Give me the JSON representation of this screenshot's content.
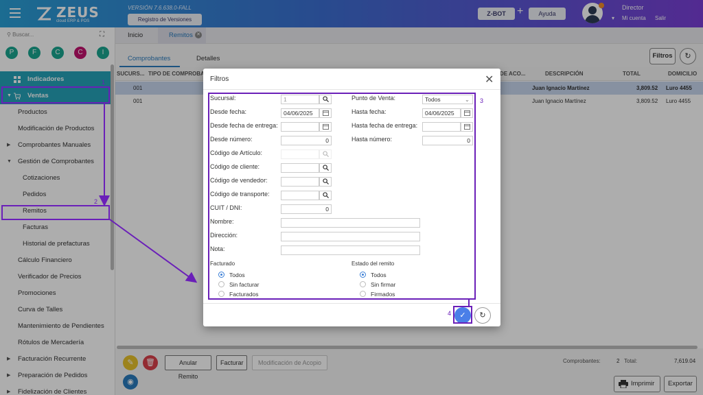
{
  "header": {
    "brand": "ZEUS",
    "brand_sub": "cloud ERP & POS",
    "version": "VERSIÓN 7.6.638.0-FALL",
    "registro_btn": "Registro de Versiones",
    "zbot_btn": "Z-BOT",
    "plus": "+",
    "ayuda_btn": "Ayuda",
    "user_role": "Director",
    "mi_cuenta": "Mi cuenta",
    "salir": "Salir"
  },
  "sidebar": {
    "search_placeholder": "Buscar...",
    "quick": [
      "P",
      "F",
      "C",
      "C",
      "I"
    ],
    "items": [
      {
        "label": "Indicadores"
      },
      {
        "label": "Ventas"
      },
      {
        "label": "Productos"
      },
      {
        "label": "Modificación de Productos"
      },
      {
        "label": "Comprobantes Manuales"
      },
      {
        "label": "Gestión de Comprobantes"
      },
      {
        "label": "Cotizaciones"
      },
      {
        "label": "Pedidos"
      },
      {
        "label": "Remitos"
      },
      {
        "label": "Facturas"
      },
      {
        "label": "Historial de prefacturas"
      },
      {
        "label": "Cálculo Financiero"
      },
      {
        "label": "Verificador de Precios"
      },
      {
        "label": "Promociones"
      },
      {
        "label": "Curva de Talles"
      },
      {
        "label": "Mantenimiento de Pendientes"
      },
      {
        "label": "Rótulos de Mercadería"
      },
      {
        "label": "Facturación Recurrente"
      },
      {
        "label": "Preparación de Pedidos"
      },
      {
        "label": "Fidelización de Clientes"
      }
    ]
  },
  "tabs": {
    "inicio": "Inicio",
    "remitos": "Remitos"
  },
  "subtabs": {
    "comprobantes": "Comprobantes",
    "detalles": "Detalles",
    "filtros_btn": "Filtros"
  },
  "grid": {
    "headers": {
      "sucursal": "SUCURS...",
      "tipo": "TIPO DE COMPROBA...",
      "acopio": "DE ACO...",
      "descripcion": "DESCRIPCIÓN",
      "total": "TOTAL",
      "domicilio": "DOMICILIO"
    },
    "rows": [
      {
        "sucursal": "001",
        "descripcion": "Juan Ignacio Martínez",
        "total": "3,809.52",
        "domicilio": "Luro 4455"
      },
      {
        "sucursal": "001",
        "descripcion": "Juan Ignacio Martínez",
        "total": "3,809.52",
        "domicilio": "Luro 4455"
      }
    ]
  },
  "bottom": {
    "anular": "Anular Remito",
    "facturar": "Facturar",
    "acopio": "Modificación de Acopio",
    "comprobantes_lbl": "Comprobantes:",
    "comprobantes_val": "2",
    "total_lbl": "Total:",
    "total_val": "7,619.04",
    "imprimir": "Imprimir",
    "exportar": "Exportar"
  },
  "modal": {
    "title": "Filtros",
    "sucursal_lbl": "Sucursal:",
    "sucursal_val": "1",
    "pv_lbl": "Punto de Venta:",
    "pv_val": "Todos",
    "desde_fecha_lbl": "Desde fecha:",
    "desde_fecha_val": "04/06/2025",
    "hasta_fecha_lbl": "Hasta fecha:",
    "hasta_fecha_val": "04/06/2025",
    "desde_entrega_lbl": "Desde fecha de entrega:",
    "hasta_entrega_lbl": "Hasta fecha de entrega:",
    "desde_num_lbl": "Desde número:",
    "desde_num_val": "0",
    "hasta_num_lbl": "Hasta número:",
    "hasta_num_val": "0",
    "articulo_lbl": "Código de Artículo:",
    "cliente_lbl": "Código de cliente:",
    "vendedor_lbl": "Código de vendedor:",
    "transporte_lbl": "Código de transporte:",
    "cuit_lbl": "CUIT / DNI:",
    "cuit_val": "0",
    "nombre_lbl": "Nombre:",
    "direccion_lbl": "Dirección:",
    "nota_lbl": "Nota:",
    "facturado_lbl": "Facturado",
    "facturado_opts": [
      "Todos",
      "Sin facturar",
      "Facturados"
    ],
    "estado_lbl": "Estado del remito",
    "estado_opts": [
      "Todos",
      "Sin firmar",
      "Firmados"
    ]
  },
  "annotations": [
    "1",
    "2",
    "3",
    "4"
  ],
  "colors": {
    "accent": "#26a3b8",
    "annotation": "#6a1fb8",
    "primary": "#4a7fe8"
  }
}
